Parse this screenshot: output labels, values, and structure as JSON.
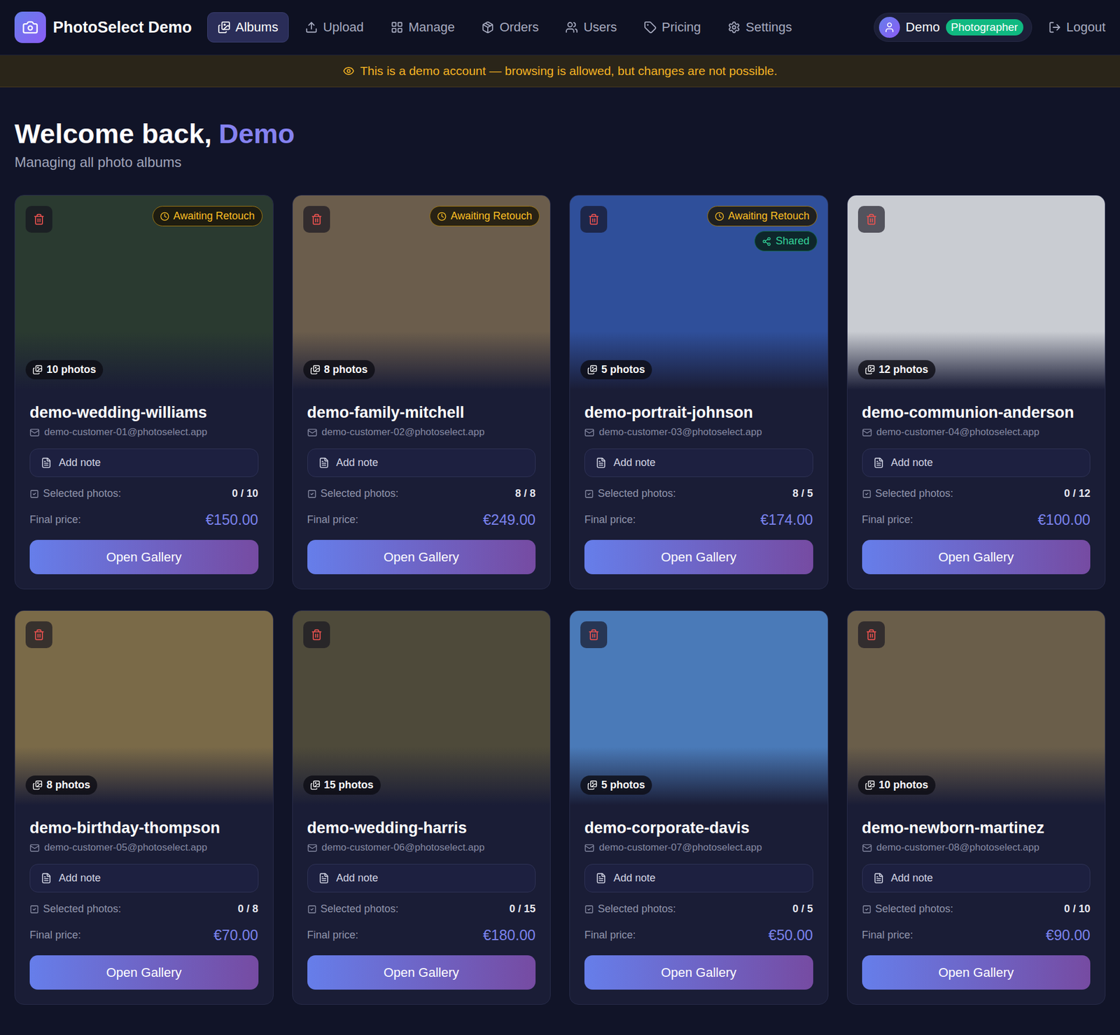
{
  "app": {
    "title": "PhotoSelect Demo"
  },
  "nav": [
    {
      "label": "Albums",
      "selected": true
    },
    {
      "label": "Upload",
      "selected": false
    },
    {
      "label": "Manage",
      "selected": false
    },
    {
      "label": "Orders",
      "selected": false
    },
    {
      "label": "Users",
      "selected": false
    },
    {
      "label": "Pricing",
      "selected": false
    },
    {
      "label": "Settings",
      "selected": false
    }
  ],
  "user": {
    "name": "Demo",
    "role": "Photographer"
  },
  "logout": "Logout",
  "banner": "This is a demo account — browsing is allowed, but changes are not possible.",
  "heading": {
    "greeting": "Welcome back,",
    "name": "Demo",
    "subtitle": "Managing all photo albums"
  },
  "albums": [
    {
      "name": "demo-wedding-williams",
      "email": "demo-customer-01@photoselect.app",
      "photos": "10 photos",
      "badges": [
        {
          "label": "Awaiting Retouch",
          "kind": "retouch"
        }
      ],
      "note": "Add note",
      "selection_label": "Selected photos:",
      "selection": "0 / 10",
      "price_label": "Final price:",
      "price": "€150.00",
      "button": "Open Gallery",
      "color": "#2a3a30"
    },
    {
      "name": "demo-family-mitchell",
      "email": "demo-customer-02@photoselect.app",
      "photos": "8 photos",
      "badges": [
        {
          "label": "Awaiting Retouch",
          "kind": "retouch"
        }
      ],
      "note": "Add note",
      "selection_label": "Selected photos:",
      "selection": "8 / 8",
      "price_label": "Final price:",
      "price": "€249.00",
      "button": "Open Gallery",
      "color": "#6b5d4c"
    },
    {
      "name": "demo-portrait-johnson",
      "email": "demo-customer-03@photoselect.app",
      "photos": "5 photos",
      "badges": [
        {
          "label": "Awaiting Retouch",
          "kind": "retouch"
        },
        {
          "label": "Shared",
          "kind": "shared"
        }
      ],
      "note": "Add note",
      "selection_label": "Selected photos:",
      "selection": "8 / 5",
      "price_label": "Final price:",
      "price": "€174.00",
      "button": "Open Gallery",
      "color": "#2f4f9a"
    },
    {
      "name": "demo-communion-anderson",
      "email": "demo-customer-04@photoselect.app",
      "photos": "12 photos",
      "badges": [],
      "note": "Add note",
      "selection_label": "Selected photos:",
      "selection": "0 / 12",
      "price_label": "Final price:",
      "price": "€100.00",
      "button": "Open Gallery",
      "color": "#c9ccd2"
    },
    {
      "name": "demo-birthday-thompson",
      "email": "demo-customer-05@photoselect.app",
      "photos": "8 photos",
      "badges": [],
      "note": "Add note",
      "selection_label": "Selected photos:",
      "selection": "0 / 8",
      "price_label": "Final price:",
      "price": "€70.00",
      "button": "Open Gallery",
      "color": "#7a6a48"
    },
    {
      "name": "demo-wedding-harris",
      "email": "demo-customer-06@photoselect.app",
      "photos": "15 photos",
      "badges": [],
      "note": "Add note",
      "selection_label": "Selected photos:",
      "selection": "0 / 15",
      "price_label": "Final price:",
      "price": "€180.00",
      "button": "Open Gallery",
      "color": "#4e4a3a"
    },
    {
      "name": "demo-corporate-davis",
      "email": "demo-customer-07@photoselect.app",
      "photos": "5 photos",
      "badges": [],
      "note": "Add note",
      "selection_label": "Selected photos:",
      "selection": "0 / 5",
      "price_label": "Final price:",
      "price": "€50.00",
      "button": "Open Gallery",
      "color": "#4a7ab8"
    },
    {
      "name": "demo-newborn-martinez",
      "email": "demo-customer-08@photoselect.app",
      "photos": "10 photos",
      "badges": [],
      "note": "Add note",
      "selection_label": "Selected photos:",
      "selection": "0 / 10",
      "price_label": "Final price:",
      "price": "€90.00",
      "button": "Open Gallery",
      "color": "#6a5e4a"
    }
  ]
}
